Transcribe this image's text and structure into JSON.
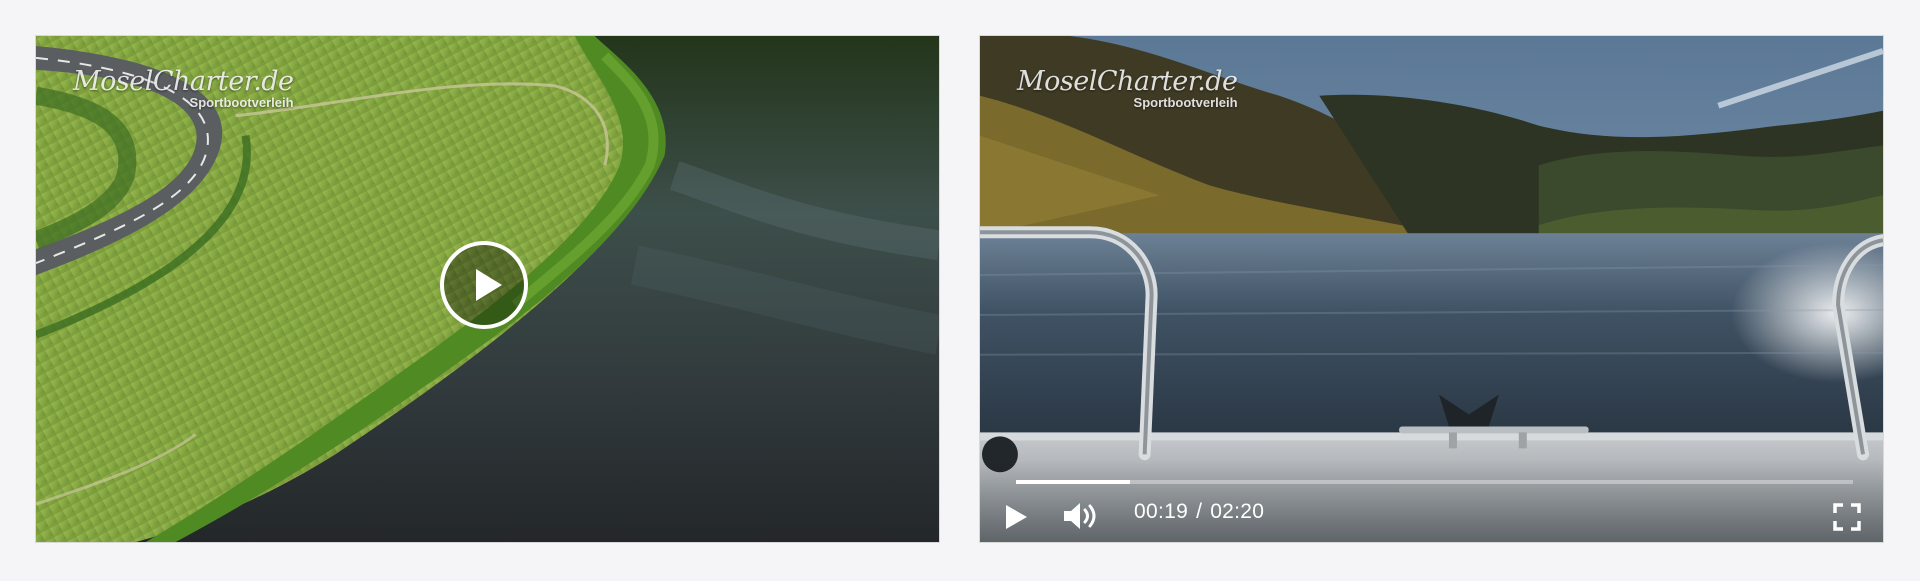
{
  "players": [
    {
      "watermark": {
        "brand": "MoselCharter.de",
        "subtitle": "Sportbootverleih"
      },
      "state": "paused",
      "overlay_icon": "play-icon"
    },
    {
      "watermark": {
        "brand": "MoselCharter.de",
        "subtitle": "Sportbootverleih"
      },
      "state": "paused",
      "controls": {
        "current_time": "00:19",
        "separator": "/",
        "duration": "02:20",
        "progress_fraction": 0.136,
        "icons": [
          "play-icon",
          "volume-icon",
          "fullscreen-icon"
        ]
      }
    }
  ],
  "colors": {
    "page_background": "#f5f5f7",
    "control_text": "#ffffff"
  }
}
